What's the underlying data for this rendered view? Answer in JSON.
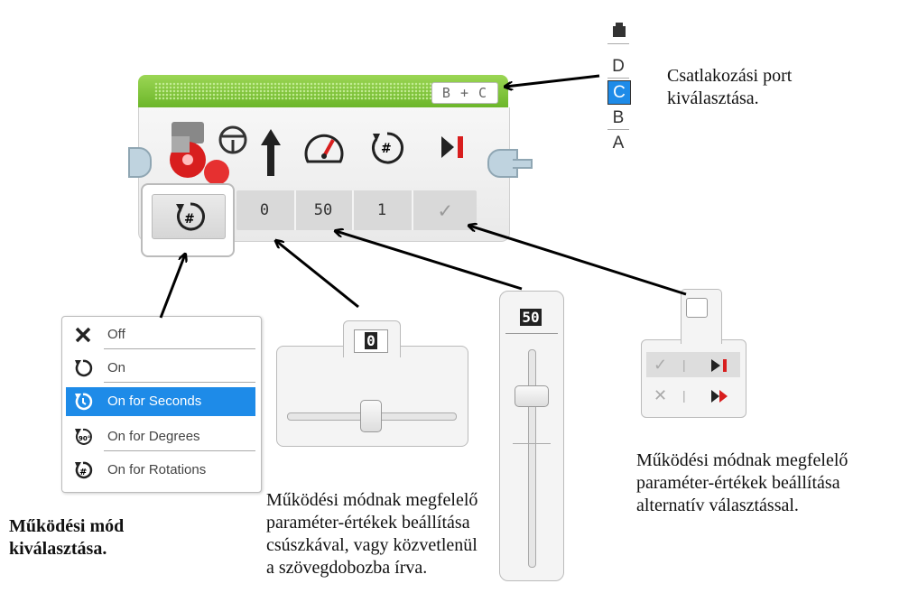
{
  "block": {
    "port_label": "B + C",
    "values": [
      "0",
      "50",
      "1",
      "✓"
    ]
  },
  "port_selector": {
    "ports": [
      "D",
      "C",
      "B",
      "A"
    ],
    "selected": "C",
    "accent_color": "#1e8be8"
  },
  "mode_menu": {
    "items": [
      {
        "label": "Off",
        "icon": "x-icon"
      },
      {
        "label": "On",
        "icon": "rotate-icon"
      },
      {
        "label": "On for Seconds",
        "icon": "clock-rotate-icon",
        "selected": true
      },
      {
        "label": "On for Degrees",
        "icon": "degrees-rotate-icon"
      },
      {
        "label": "On for Rotations",
        "icon": "hash-rotate-icon"
      }
    ]
  },
  "h_slider": {
    "value": "0"
  },
  "v_slider": {
    "value": "50"
  },
  "alt_chooser": {
    "rows": [
      {
        "left": "✓",
        "sep": "|",
        "right_icon": "brake-icon"
      },
      {
        "left": "✕",
        "sep": "|",
        "right_icon": "coast-icon"
      }
    ]
  },
  "captions": {
    "port": [
      "Csatlakozási port",
      "kiválasztása."
    ],
    "mode": [
      "Működési mód",
      "kiválasztása."
    ],
    "slider": [
      "Működési módnak megfelelő",
      "paraméter-értékek beállítása",
      "csúszkával, vagy közvetlenül",
      "a szövegdobozba írva."
    ],
    "alt": [
      "Működési módnak megfelelő",
      "paraméter-értékek beállítása",
      "alternatív választással."
    ]
  }
}
